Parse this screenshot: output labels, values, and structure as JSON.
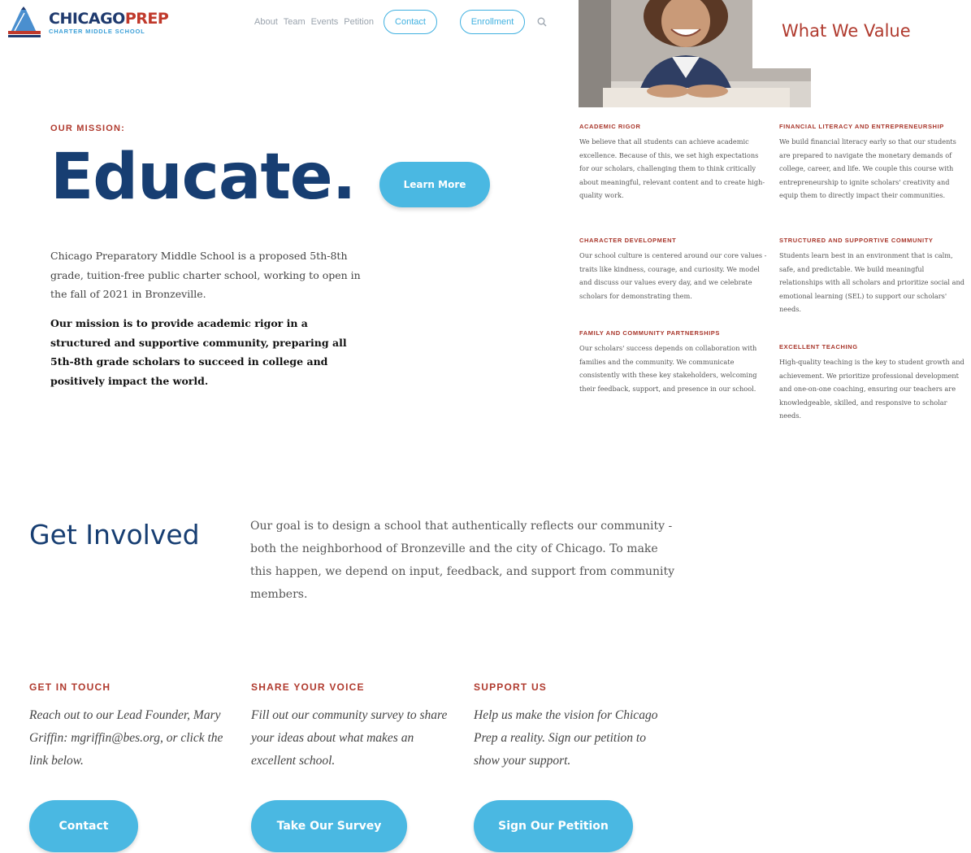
{
  "header": {
    "logo_main_1": "CHICAGO",
    "logo_main_2": "PREP",
    "logo_sub": "CHARTER MIDDLE SCHOOL",
    "nav": [
      "About",
      "Team",
      "Events",
      "Petition"
    ],
    "contact_label": "Contact",
    "enrollment_label": "Enrollment"
  },
  "mission": {
    "label": "OUR MISSION:",
    "headline": "Educate.",
    "learn_more": "Learn More",
    "p1": "Chicago Preparatory Middle School is a proposed 5th-8th grade, tuition-free public charter school, working to open in the fall of 2021 in Bronzeville.",
    "p2": "Our mission is to provide academic rigor in a structured and supportive community, preparing all 5th-8th grade scholars to succeed in college and positively impact the world."
  },
  "values": {
    "title": "What We Value",
    "items": [
      {
        "head": "ACADEMIC RIGOR",
        "text": "We believe that all students can achieve academic excellence. Because of this, we set high expectations for our scholars, challenging them to think critically about meaningful, relevant content and to create high-quality work."
      },
      {
        "head": "FINANCIAL LITERACY AND ENTREPRENEURSHIP",
        "text": "We build financial literacy early so that our students are prepared to navigate the monetary demands of college, career, and life. We couple this course with entrepreneurship to ignite scholars' creativity and equip them to directly impact their communities."
      },
      {
        "head": "CHARACTER DEVELOPMENT",
        "text": "Our school culture is centered around our core values - traits like kindness, courage, and curiosity. We model and discuss our values every day, and we celebrate scholars for demonstrating them."
      },
      {
        "head": "STRUCTURED AND SUPPORTIVE COMMUNITY",
        "text": "Students learn best in an environment that is calm, safe, and predictable. We build meaningful relationships with all scholars and prioritize social and emotional learning (SEL) to support our scholars' needs."
      },
      {
        "head": "FAMILY AND COMMUNITY PARTNERSHIPS",
        "text": "Our scholars' success depends on collaboration with families and the community. We communicate consistently with these key stakeholders, welcoming their feedback, support, and presence in our school."
      },
      {
        "head": "EXCELLENT TEACHING",
        "text": "High-quality teaching is the key to student growth and achievement. We prioritize professional development and one-on-one coaching, ensuring our teachers are knowledgeable, skilled, and responsive to scholar needs."
      }
    ]
  },
  "involved": {
    "title": "Get Involved",
    "text": "Our goal is to design a school that authentically reflects our community - both the neighborhood of Bronzeville and the city of Chicago. To make this happen, we depend on input, feedback, and support from community members.",
    "columns": [
      {
        "head": "GET IN TOUCH",
        "text": "Reach out to our Lead Founder, Mary Griffin: mgriffin@bes.org, or click the link below.",
        "button": "Contact"
      },
      {
        "head": "SHARE YOUR VOICE",
        "text": "Fill out our community survey to share your ideas about what makes an excellent school.",
        "button": "Take Our Survey"
      },
      {
        "head": "SUPPORT US",
        "text": "Help us make the vision for Chicago Prep a reality. Sign our petition to show your support.",
        "button": "Sign Our Petition"
      }
    ]
  },
  "colors": {
    "navy": "#173e72",
    "red": "#b03a2e",
    "button_blue": "#4ab8e2"
  }
}
